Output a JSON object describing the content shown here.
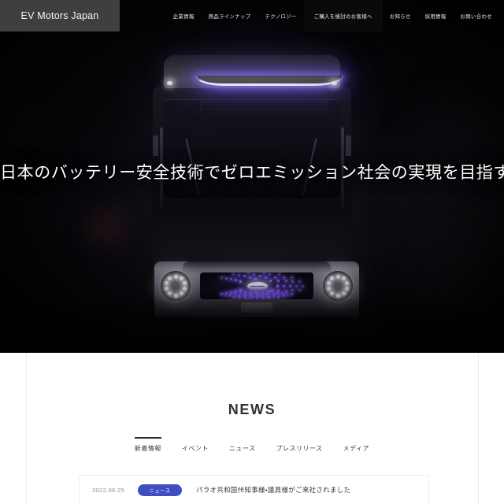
{
  "site": {
    "logo_text": "EV Motors Japan"
  },
  "nav": {
    "items": [
      {
        "label": "企業情報",
        "highlight": false
      },
      {
        "label": "商品ラインナップ",
        "highlight": false
      },
      {
        "label": "テクノロジー",
        "highlight": false
      },
      {
        "label": "ご購入を検討のお客様へ",
        "highlight": true
      },
      {
        "label": "お知らせ",
        "highlight": false
      },
      {
        "label": "採用情報",
        "highlight": false
      },
      {
        "label": "お問い合わせ",
        "highlight": false
      }
    ]
  },
  "hero": {
    "headline": "日本のバッテリー安全技術でゼロエミッション社会の実現を目指す",
    "background_color": "#000000",
    "led_accent_color": "#8f6cff"
  },
  "news": {
    "heading": "NEWS",
    "tabs": [
      {
        "label": "新着情報",
        "active": true
      },
      {
        "label": "イベント",
        "active": false
      },
      {
        "label": "ニュース",
        "active": false
      },
      {
        "label": "プレスリリース",
        "active": false
      },
      {
        "label": "メディア",
        "active": false
      }
    ],
    "items": [
      {
        "date": "2022.08.25",
        "category": "ニュース",
        "category_color": "#3f4fbf",
        "title": "パラオ共和国州知事様・議員様がご来社されました"
      }
    ]
  }
}
